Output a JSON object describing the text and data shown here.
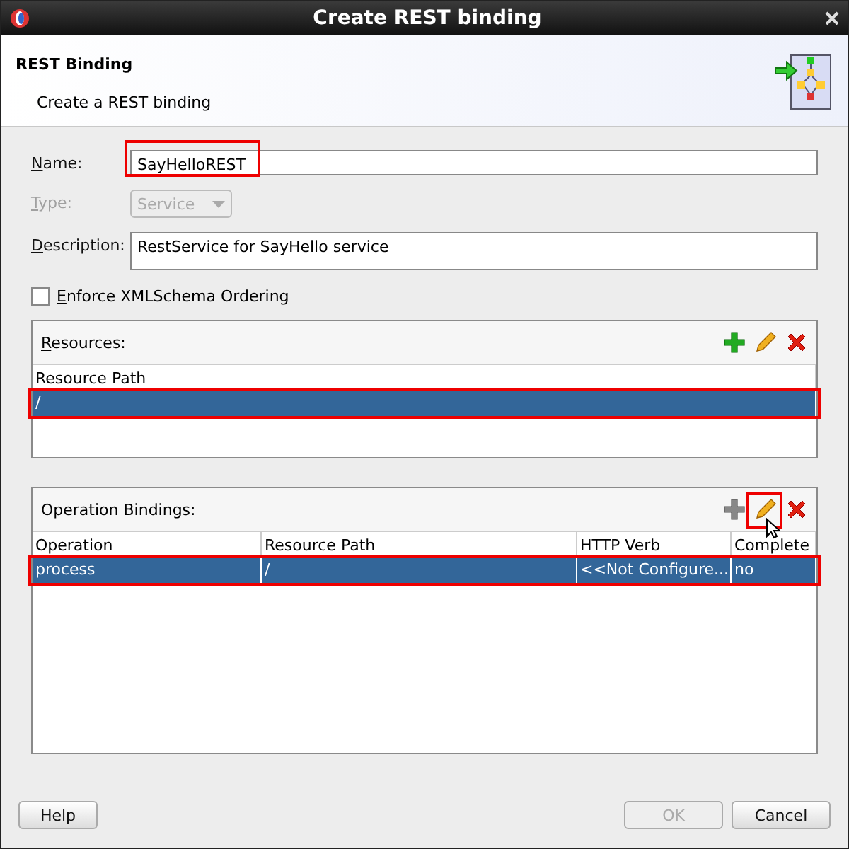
{
  "window": {
    "title": "Create REST binding"
  },
  "header": {
    "title": "REST Binding",
    "subtitle": "Create a REST binding"
  },
  "form": {
    "name": {
      "label": "Name:",
      "value": "SayHelloREST",
      "highlighted": true
    },
    "type": {
      "label": "Type:",
      "value": "Service",
      "disabled": true
    },
    "description": {
      "label": "Description:",
      "value": "RestService for SayHello service"
    },
    "enforce_ordering": {
      "label": "Enforce XMLSchema Ordering",
      "checked": false
    }
  },
  "resources": {
    "title": "Resources:",
    "mnemonic": true,
    "columns": [
      "Resource Path"
    ],
    "rows": [
      {
        "cells": [
          "/"
        ],
        "selected": true,
        "highlighted": true
      }
    ]
  },
  "operation_bindings": {
    "title": "Operation Bindings:",
    "mnemonic": false,
    "columns": [
      "Operation",
      "Resource Path",
      "HTTP Verb",
      "Complete"
    ],
    "rows": [
      {
        "cells": [
          "process",
          "/",
          "<<Not Configure...",
          "no"
        ],
        "selected": true,
        "highlighted": true
      }
    ]
  },
  "buttons": [
    {
      "label": "Help",
      "disabled": false
    },
    {
      "label": "OK",
      "disabled": true
    },
    {
      "label": "Cancel",
      "disabled": false
    }
  ]
}
